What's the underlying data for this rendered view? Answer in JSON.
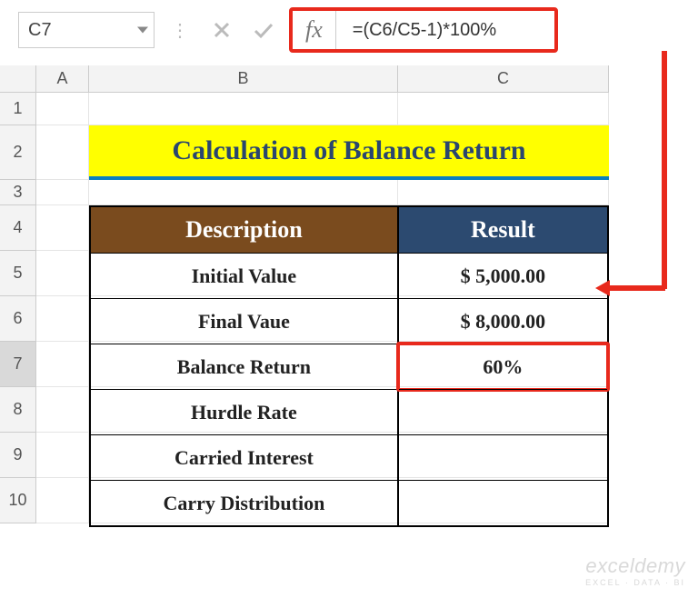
{
  "namebox": {
    "value": "C7"
  },
  "formula_bar": {
    "fx_label": "fx",
    "formula": "=(C6/C5-1)*100%"
  },
  "columns": {
    "A": "A",
    "B": "B",
    "C": "C"
  },
  "row_numbers": [
    "1",
    "2",
    "3",
    "4",
    "5",
    "6",
    "7",
    "8",
    "9",
    "10"
  ],
  "title": "Calculation of Balance Return",
  "table": {
    "headers": {
      "desc": "Description",
      "result": "Result"
    },
    "rows": [
      {
        "desc": "Initial Value",
        "result": "$ 5,000.00"
      },
      {
        "desc": "Final Vaue",
        "result": "$ 8,000.00"
      },
      {
        "desc": "Balance Return",
        "result": "60%"
      },
      {
        "desc": "Hurdle Rate",
        "result": ""
      },
      {
        "desc": "Carried Interest",
        "result": ""
      },
      {
        "desc": "Carry Distribution",
        "result": ""
      }
    ]
  },
  "watermark": {
    "line1": "exceldemy",
    "line2": "EXCEL · DATA · BI"
  },
  "chart_data": {
    "type": "table",
    "title": "Calculation of Balance Return",
    "columns": [
      "Description",
      "Result"
    ],
    "rows": [
      [
        "Initial Value",
        5000.0
      ],
      [
        "Final Vaue",
        8000.0
      ],
      [
        "Balance Return",
        "60%"
      ],
      [
        "Hurdle Rate",
        null
      ],
      [
        "Carried Interest",
        null
      ],
      [
        "Carry Distribution",
        null
      ]
    ],
    "selected_cell": "C7",
    "formula": "=(C6/C5-1)*100%"
  }
}
